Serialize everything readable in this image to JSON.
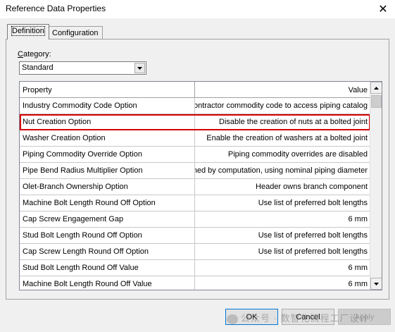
{
  "window": {
    "title": "Reference Data Properties",
    "close_glyph": "✕"
  },
  "tabs": [
    {
      "label": "Definition",
      "active": true
    },
    {
      "label": "Configuration",
      "active": false
    }
  ],
  "category": {
    "label_prefix": "C",
    "label_rest": "ategory:",
    "value": "Standard"
  },
  "grid": {
    "columns": {
      "property": "Property",
      "value": "Value"
    },
    "rows": [
      {
        "property": "Industry Commodity Code Option",
        "value": "Use contractor commodity code to access piping catalog"
      },
      {
        "property": "Nut Creation Option",
        "value": "Disable the creation of nuts at a bolted joint",
        "highlighted": true
      },
      {
        "property": "Washer Creation Option",
        "value": "Enable the creation of washers at a bolted joint"
      },
      {
        "property": "Piping Commodity Override Option",
        "value": "Piping commodity overrides are disabled"
      },
      {
        "property": "Pipe Bend Radius Multiplier Option",
        "value": "Bend radius determined by computation, using nominal piping diameter"
      },
      {
        "property": "Olet-Branch Ownership Option",
        "value": "Header owns branch component"
      },
      {
        "property": "Machine Bolt Length Round Off Option",
        "value": "Use list of preferred bolt lengths"
      },
      {
        "property": "Cap Screw Engagement Gap",
        "value": "6 mm"
      },
      {
        "property": "Stud Bolt Length Round Off Option",
        "value": "Use list of preferred bolt lengths"
      },
      {
        "property": "Cap Screw Length Round Off Option",
        "value": "Use list of preferred bolt lengths"
      },
      {
        "property": "Stud Bolt Length Round Off Value",
        "value": "6 mm"
      },
      {
        "property": "Machine Bolt Length Round Off Value",
        "value": "6 mm"
      }
    ],
    "highlight_color": "#d40000"
  },
  "buttons": {
    "ok": "OK",
    "cancel": "Cancel",
    "apply": "Apply"
  },
  "watermark": "公众号 · 数智化流程工厂设计"
}
